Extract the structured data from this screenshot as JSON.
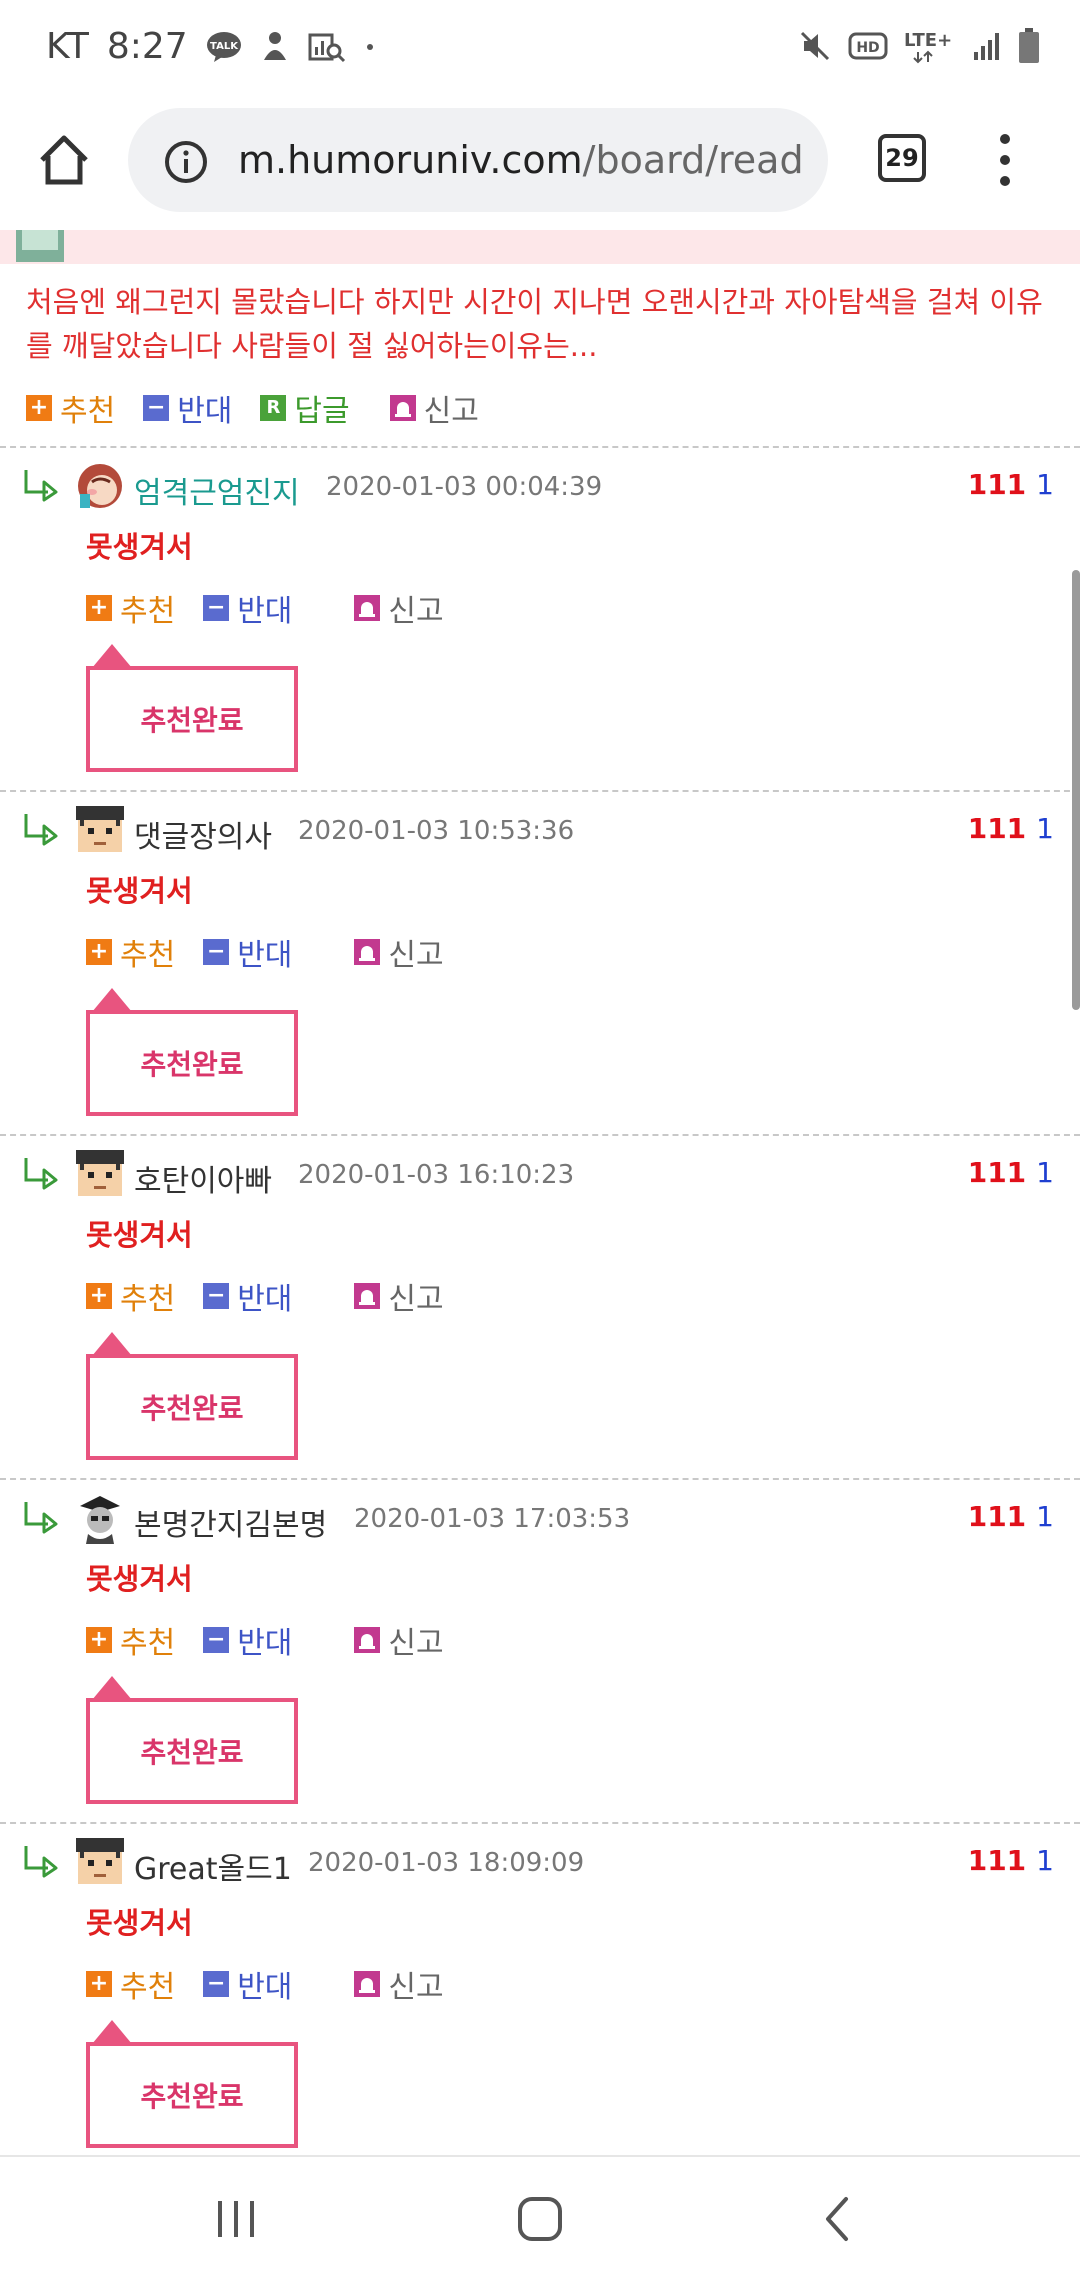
{
  "status_bar": {
    "carrier": "KT",
    "time": "8:27",
    "talk_badge": "TALK",
    "network": "LTE+",
    "hd_badge": "HD"
  },
  "browser": {
    "url_host": "m.humoruniv.com",
    "url_path": "/board/read",
    "tab_count": "29"
  },
  "post": {
    "body": "처음엔 왜그런지 몰랐습니다 하지만 시간이 지나면 오랜시간과 자아탐색을 걸쳐 이유를 깨달았습니다 사람들이 절 싫어하는이유는...",
    "actions": {
      "recommend": "추천",
      "oppose": "반대",
      "reply": "답글",
      "report": "신고"
    },
    "reply_badge": "R"
  },
  "comments": [
    {
      "name": "엄격근엄진지",
      "date": "2020-01-03 00:04:39",
      "up": "111",
      "down": "1",
      "text": "못생겨서",
      "recommend": "추천",
      "oppose": "반대",
      "report": "신고",
      "done": "추천완료"
    },
    {
      "name": "댓글장의사",
      "date": "2020-01-03 10:53:36",
      "up": "111",
      "down": "1",
      "text": "못생겨서",
      "recommend": "추천",
      "oppose": "반대",
      "report": "신고",
      "done": "추천완료"
    },
    {
      "name": "호탄이아빠",
      "date": "2020-01-03 16:10:23",
      "up": "111",
      "down": "1",
      "text": "못생겨서",
      "recommend": "추천",
      "oppose": "반대",
      "report": "신고",
      "done": "추천완료"
    },
    {
      "name": "본명간지김본명",
      "date": "2020-01-03 17:03:53",
      "up": "111",
      "down": "1",
      "text": "못생겨서",
      "recommend": "추천",
      "oppose": "반대",
      "report": "신고",
      "done": "추천완료"
    },
    {
      "name": "Great올드1",
      "date": "2020-01-03 18:09:09",
      "up": "111",
      "down": "1",
      "text": "못생겨서",
      "recommend": "추천",
      "oppose": "반대",
      "report": "신고",
      "done": "추천완료"
    }
  ],
  "icons": {
    "plus_symbol": "+",
    "minus_symbol": "−"
  },
  "colors": {
    "post_text": "#e03030",
    "vote_up": "#e0101a",
    "vote_down": "#1f3fd0",
    "done_border": "#e8547f"
  }
}
